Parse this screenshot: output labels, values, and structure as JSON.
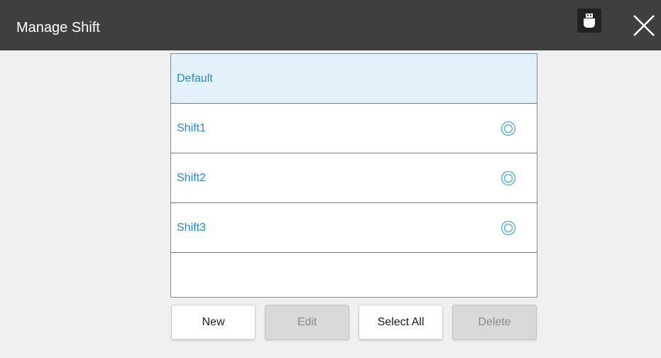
{
  "header": {
    "title": "Manage Shift",
    "usb_icon": "usb-drive-icon",
    "close_icon": "close-icon"
  },
  "shifts": [
    {
      "label": "Default",
      "selected": true,
      "has_icon": false
    },
    {
      "label": "Shift1",
      "selected": false,
      "has_icon": true
    },
    {
      "label": "Shift2",
      "selected": false,
      "has_icon": true
    },
    {
      "label": "Shift3",
      "selected": false,
      "has_icon": true
    }
  ],
  "buttons": {
    "new_label": "New",
    "edit_label": "Edit",
    "select_all_label": "Select All",
    "delete_label": "Delete"
  },
  "colors": {
    "header_bg": "#3f3f3f",
    "selected_row_bg": "#e3f2fa",
    "item_text": "#2a87d0",
    "disabled_button_bg": "#d9d9d9"
  }
}
